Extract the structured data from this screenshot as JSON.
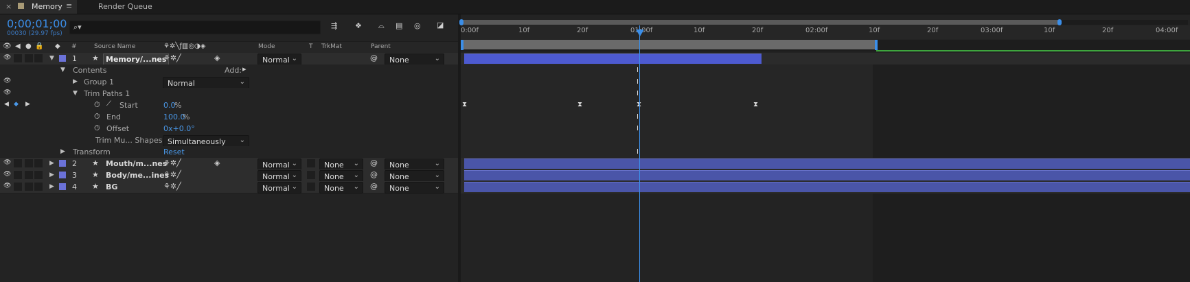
{
  "tabs": {
    "close_glyph": "×",
    "comp_tab": "Memory",
    "menu_glyph": "≡",
    "render_queue": "Render Queue"
  },
  "timecode": {
    "value": "0;00;01;00",
    "frames": "00030 (29.97 fps)"
  },
  "search": {
    "icon": "⌕▾"
  },
  "columns": {
    "number": "#",
    "source_name": "Source Name",
    "mode": "Mode",
    "t": "T",
    "trkmat": "TrkMat",
    "parent": "Parent"
  },
  "layers": [
    {
      "num": "1",
      "name": "Memory/...nes",
      "mode": "Normal",
      "trkmat": "",
      "parent": "None"
    },
    {
      "num": "2",
      "name": "Mouth/m...nes",
      "mode": "Normal",
      "trkmat": "None",
      "parent": "None"
    },
    {
      "num": "3",
      "name": "Body/me...ines",
      "mode": "Normal",
      "trkmat": "None",
      "parent": "None"
    },
    {
      "num": "4",
      "name": "BG",
      "mode": "Normal",
      "trkmat": "None",
      "parent": "None"
    }
  ],
  "props": {
    "contents": "Contents",
    "add": "Add:",
    "group1": "Group 1",
    "group1_mode": "Normal",
    "trim_paths": "Trim Paths 1",
    "start": "Start",
    "start_val": "0.0",
    "start_unit": "%",
    "end": "End",
    "end_val": "100.0",
    "end_unit": "%",
    "offset": "Offset",
    "offset_val": "0x+0.0°",
    "trim_multi": "Trim Mu... Shapes",
    "trim_multi_val": "Simultaneously",
    "transform": "Transform",
    "reset": "Reset"
  },
  "ruler": [
    "0:00f",
    "10f",
    "20f",
    "01:00f",
    "10f",
    "20f",
    "02:00f",
    "10f",
    "20f",
    "03:00f",
    "10f",
    "20f",
    "04:00f"
  ],
  "colors": {
    "accent_blue": "#4a98e8",
    "layer_bar": "#4a55a8",
    "label_purple": "#6b72d8",
    "work_area_green": "#3ea63e"
  }
}
